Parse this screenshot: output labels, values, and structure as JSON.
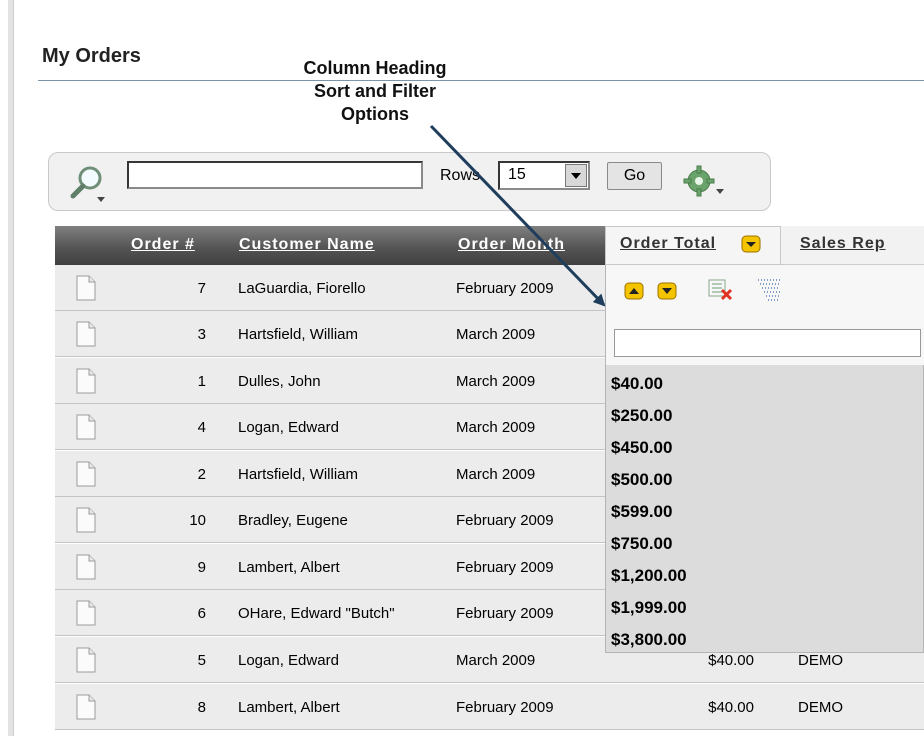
{
  "page": {
    "title": "My Orders"
  },
  "annotation": {
    "lines": [
      "Column Heading",
      "Sort and Filter",
      "Options"
    ]
  },
  "search": {
    "value": "",
    "rows_label": "Rows",
    "rows_value": "15",
    "go_label": "Go"
  },
  "columns": [
    "Order #",
    "Customer Name",
    "Order Month",
    "Order Total",
    "Sales Rep"
  ],
  "rows": [
    {
      "order": "7",
      "customer": "LaGuardia, Fiorello",
      "month": "February 2009",
      "total": "",
      "rep": ""
    },
    {
      "order": "3",
      "customer": "Hartsfield, William",
      "month": "March 2009",
      "total": "",
      "rep": ""
    },
    {
      "order": "1",
      "customer": "Dulles, John",
      "month": "March 2009",
      "total": "",
      "rep": ""
    },
    {
      "order": "4",
      "customer": "Logan, Edward",
      "month": "March 2009",
      "total": "",
      "rep": ""
    },
    {
      "order": "2",
      "customer": "Hartsfield, William",
      "month": "March 2009",
      "total": "",
      "rep": ""
    },
    {
      "order": "10",
      "customer": "Bradley, Eugene",
      "month": "February 2009",
      "total": "",
      "rep": ""
    },
    {
      "order": "9",
      "customer": "Lambert, Albert",
      "month": "February 2009",
      "total": "",
      "rep": ""
    },
    {
      "order": "6",
      "customer": "OHare, Edward \"Butch\"",
      "month": "February 2009",
      "total": "",
      "rep": ""
    },
    {
      "order": "5",
      "customer": "Logan, Edward",
      "month": "March 2009",
      "total": "$40.00",
      "rep": "DEMO"
    },
    {
      "order": "8",
      "customer": "Lambert, Albert",
      "month": "February 2009",
      "total": "$40.00",
      "rep": "DEMO"
    }
  ],
  "filter": {
    "search_value": "",
    "values": [
      "$40.00",
      "$250.00",
      "$450.00",
      "$500.00",
      "$599.00",
      "$750.00",
      "$1,200.00",
      "$1,999.00",
      "$3,800.00"
    ]
  }
}
